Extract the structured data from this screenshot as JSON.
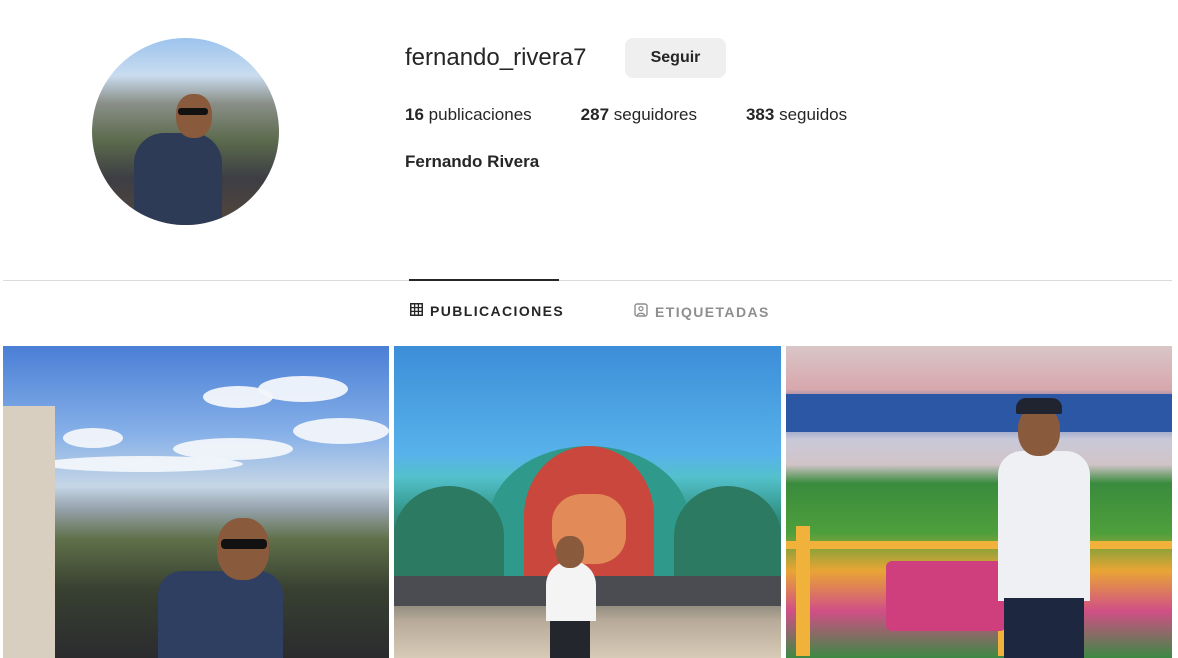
{
  "profile": {
    "username": "fernando_rivera7",
    "follow_label": "Seguir",
    "posts_count": "16",
    "posts_label": "publicaciones",
    "followers_count": "287",
    "followers_label": "seguidores",
    "following_count": "383",
    "following_label": "seguidos",
    "full_name": "Fernando Rivera",
    "avatar_icon": "profile-photo"
  },
  "tabs": [
    {
      "label": "PUBLICACIONES",
      "icon": "grid-icon",
      "active": true
    },
    {
      "label": "ETIQUETADAS",
      "icon": "tagged-icon",
      "active": false
    }
  ],
  "posts": [
    {
      "icon": "photo-montmartre"
    },
    {
      "icon": "photo-festival-stage"
    },
    {
      "icon": "photo-stadium"
    }
  ],
  "colors": {
    "text": "#262626",
    "muted": "#8e8e8e",
    "button_bg": "#efefef",
    "divider": "#dbdbdb"
  }
}
